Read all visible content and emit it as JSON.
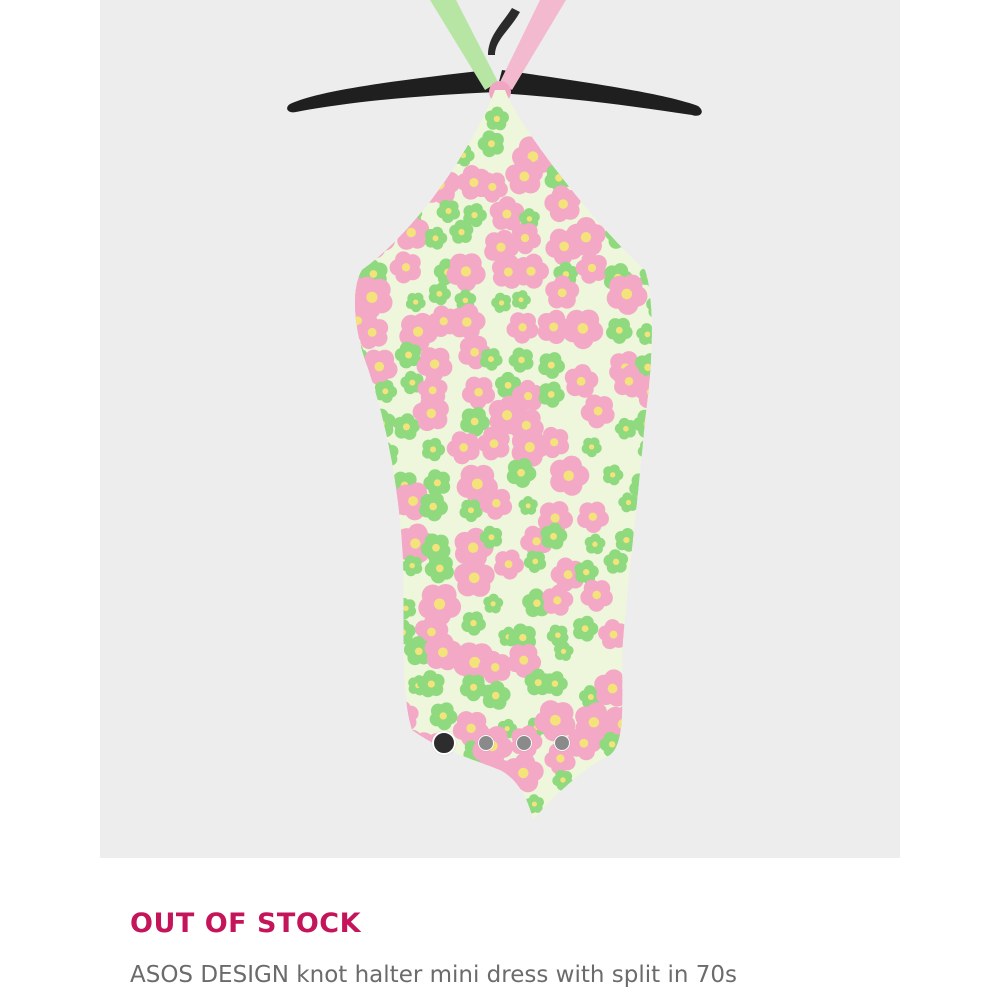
{
  "product": {
    "status": "OUT OF STOCK",
    "title": "ASOS DESIGN knot halter mini dress with split in 70s",
    "image_icon": "floral-halter-dress-photo"
  },
  "carousel": {
    "total_slides": 4,
    "active_index": 0
  },
  "colors": {
    "status": "#c4145a",
    "title": "#6b6b6b",
    "image_background": "#ededed",
    "dress_base": "#eef6dc",
    "flower_pink": "#f3a9c6",
    "flower_green": "#8fd97f",
    "flower_yellow": "#f4e27a"
  }
}
